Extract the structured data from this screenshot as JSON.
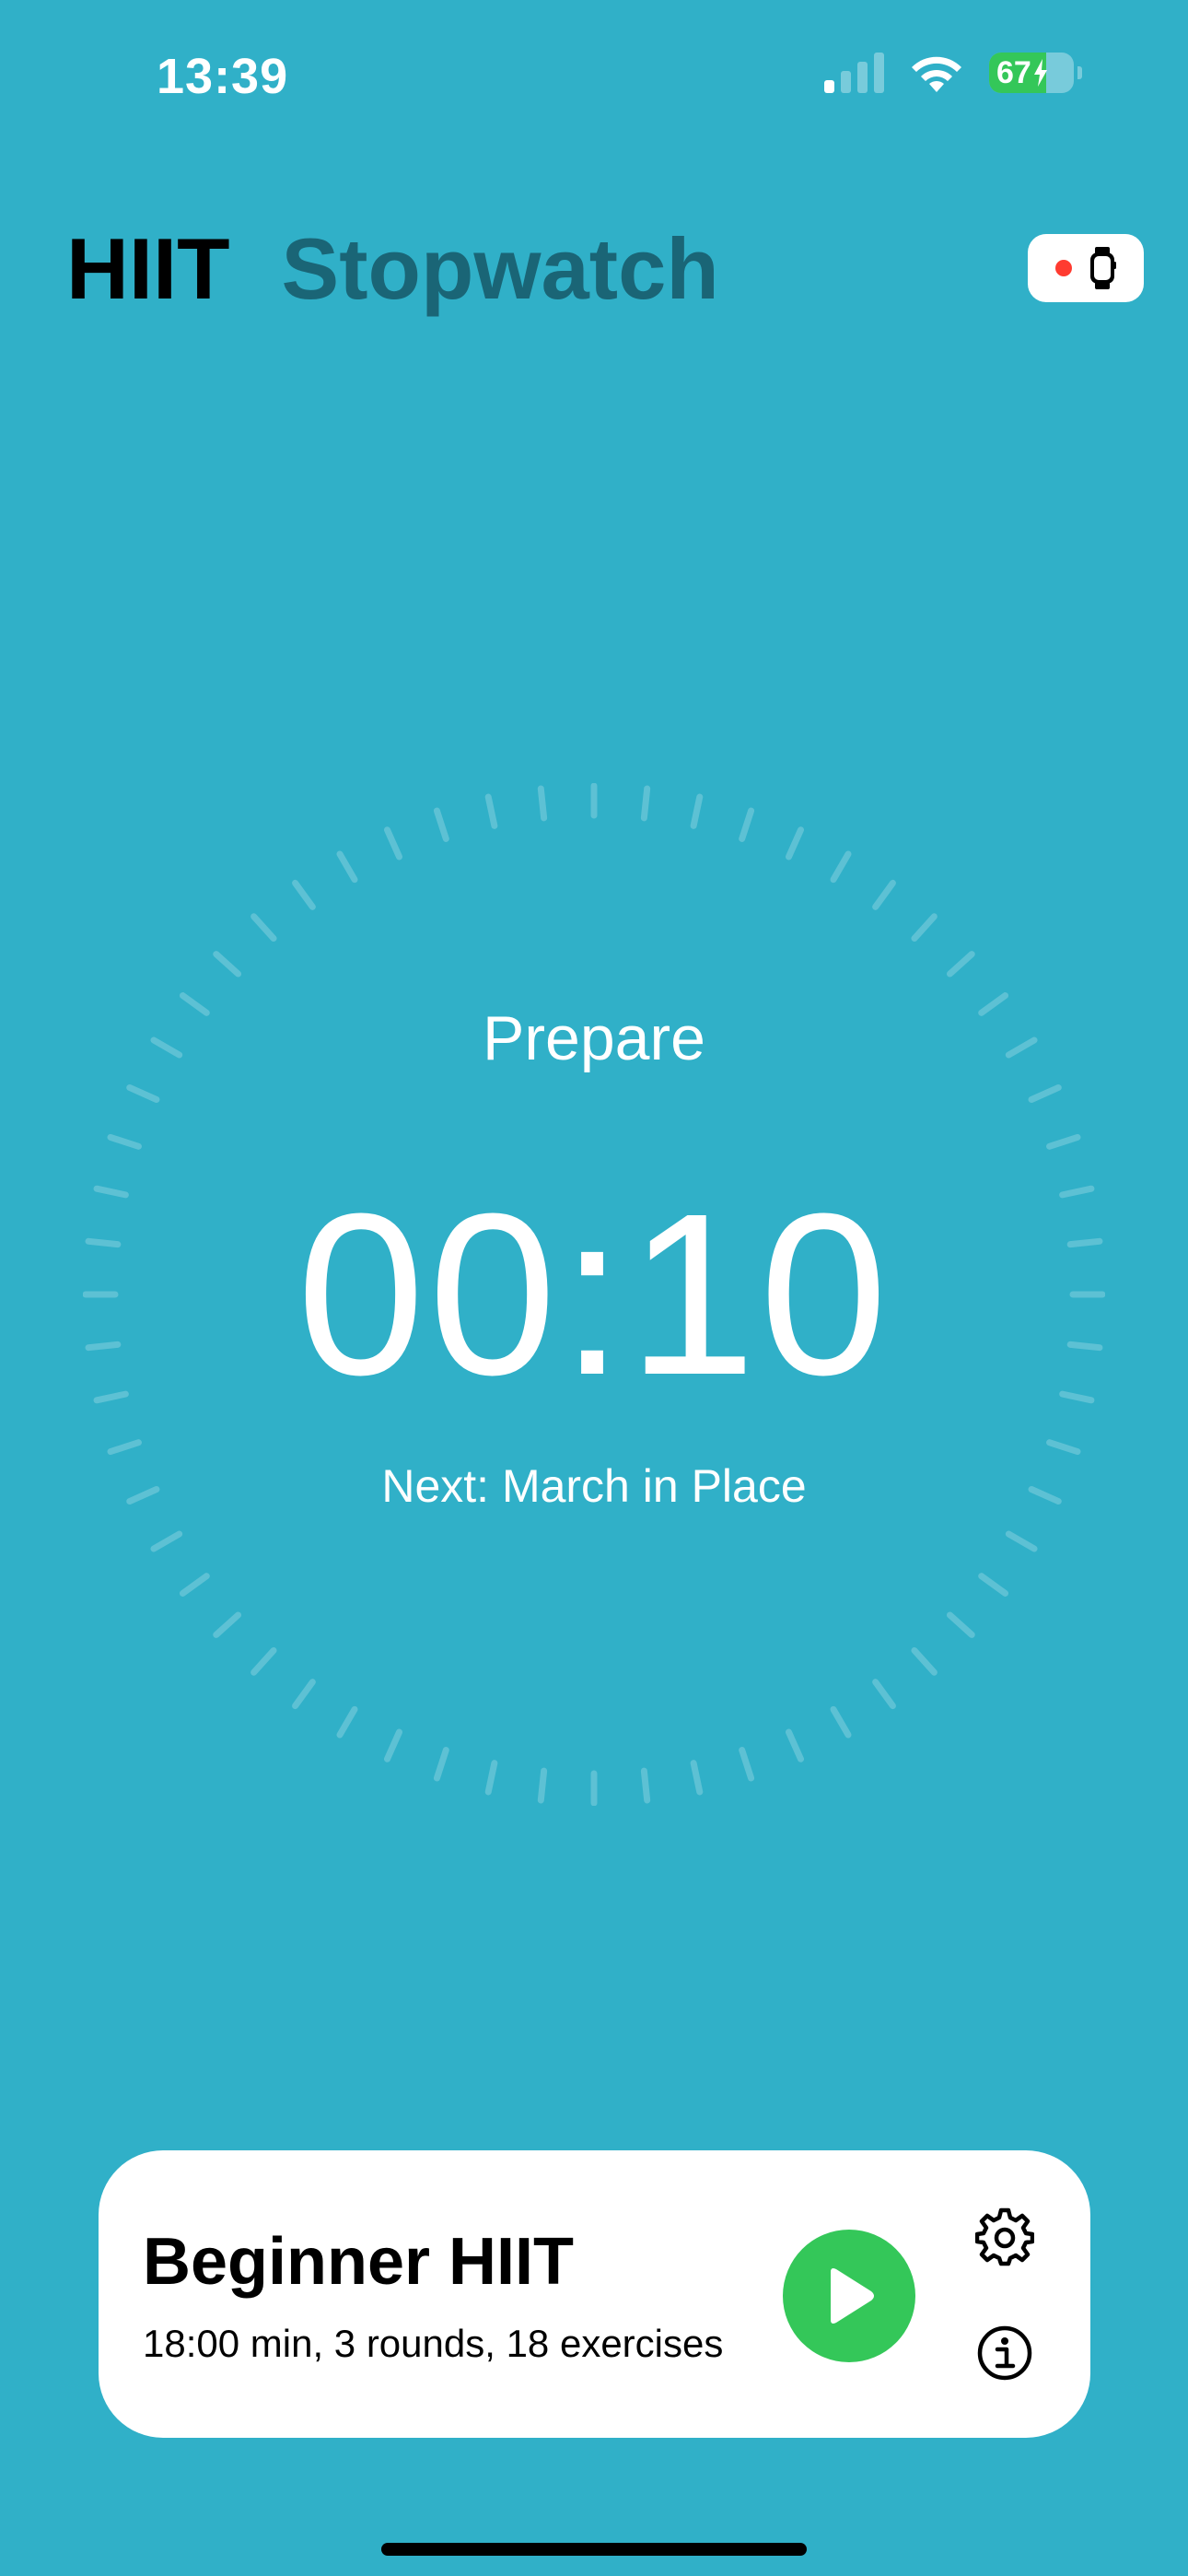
{
  "status_bar": {
    "time": "13:39",
    "battery_percent": "67",
    "battery_level": 0.67,
    "signal_bars_on": 1,
    "signal_bars_total": 4
  },
  "header": {
    "tabs": [
      {
        "label": "HIIT",
        "selected": true
      },
      {
        "label": "Stopwatch",
        "selected": false
      }
    ]
  },
  "timer": {
    "phase": "Prepare",
    "time": "00:10",
    "next": "Next: March in Place"
  },
  "workout_card": {
    "title": "Beginner HIIT",
    "subtitle": "18:00 min, 3 rounds, 18 exercises"
  },
  "icons": {
    "watch": "apple-watch-icon",
    "play": "play-icon",
    "settings": "gear-icon",
    "info": "info-circle-icon"
  },
  "colors": {
    "background": "#30b0c8",
    "tab_inactive": "#1a6576",
    "play": "#34c759",
    "recording_dot": "#ff3b30",
    "battery_fill": "#34c759"
  }
}
